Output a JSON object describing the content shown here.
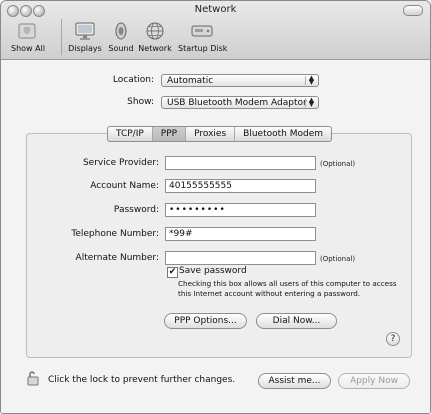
{
  "window": {
    "title": "Network"
  },
  "toolbar": {
    "items": [
      {
        "label": "Show All",
        "icon": "apple-icon"
      },
      {
        "label": "Displays",
        "icon": "display-icon"
      },
      {
        "label": "Sound",
        "icon": "speaker-icon"
      },
      {
        "label": "Network",
        "icon": "globe-icon"
      },
      {
        "label": "Startup Disk",
        "icon": "disk-icon"
      }
    ]
  },
  "location": {
    "label": "Location:",
    "value": "Automatic"
  },
  "show": {
    "label": "Show:",
    "value": "USB Bluetooth Modem Adaptor"
  },
  "tabs": [
    {
      "label": "TCP/IP",
      "selected": false
    },
    {
      "label": "PPP",
      "selected": true
    },
    {
      "label": "Proxies",
      "selected": false
    },
    {
      "label": "Bluetooth Modem",
      "selected": false
    }
  ],
  "ppp": {
    "service_provider": {
      "label": "Service Provider:",
      "value": "",
      "note": "(Optional)"
    },
    "account_name": {
      "label": "Account Name:",
      "value": "40155555555"
    },
    "password": {
      "label": "Password:",
      "value": "•••••••••"
    },
    "telephone_number": {
      "label": "Telephone Number:",
      "value": "*99#"
    },
    "alternate_number": {
      "label": "Alternate Number:",
      "value": "",
      "note": "(Optional)"
    },
    "save_password": {
      "label": "Save password",
      "checked": true,
      "hint": "Checking this box allows all users of this computer to access this Internet account without entering a password."
    },
    "ppp_options_button": "PPP Options...",
    "dial_now_button": "Dial Now...",
    "help_button": "?"
  },
  "footer": {
    "lock_text": "Click the lock to prevent further changes.",
    "assist_button": "Assist me...",
    "apply_button": "Apply Now"
  }
}
